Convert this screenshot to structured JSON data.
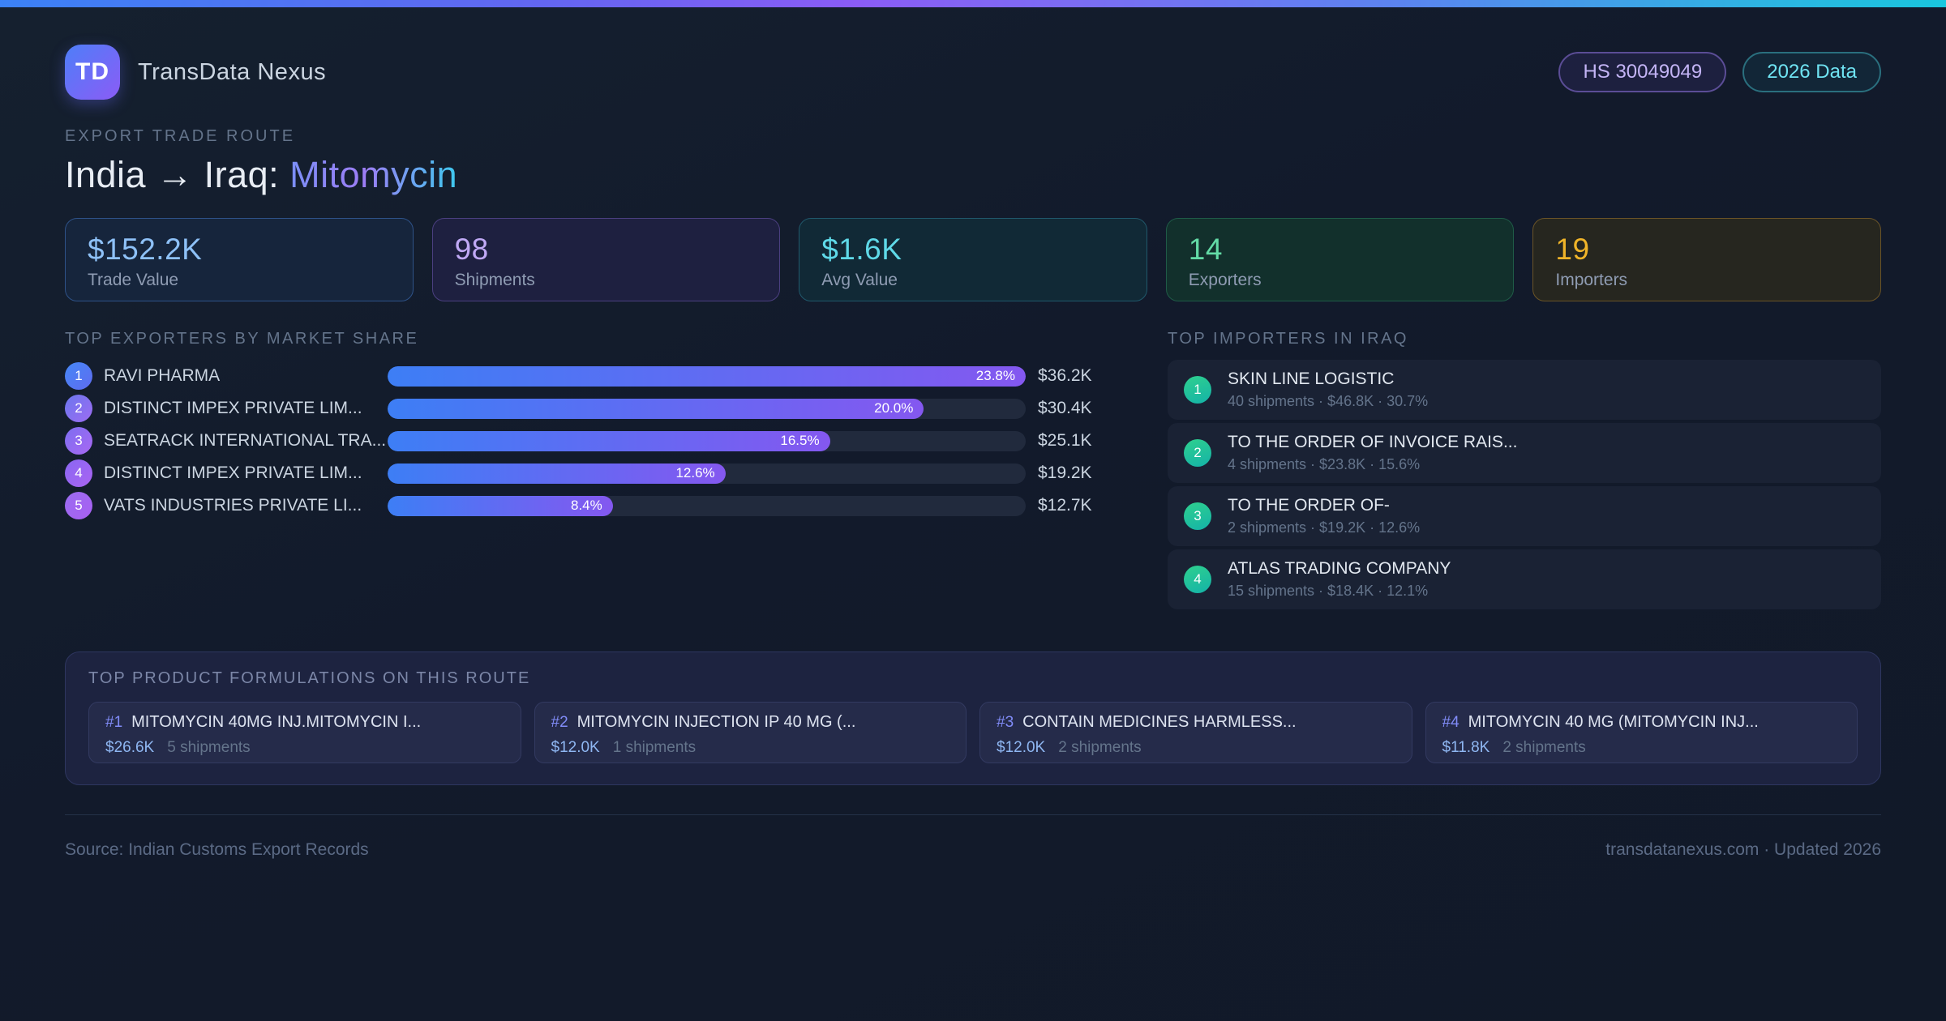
{
  "brand": {
    "logo_text": "TD",
    "app_name": "TransData Nexus"
  },
  "header_badges": {
    "hs_code": "HS 30049049",
    "year_badge": "2026 Data"
  },
  "hero": {
    "eyebrow": "EXPORT TRADE ROUTE",
    "route_label": "India → Iraq:",
    "product": "Mitomycin"
  },
  "colors": {
    "topbar_gradient": [
      "#3b82f6",
      "#8b5cf6",
      "#22d3ee"
    ],
    "bar_fill_start": "#3d7ef5",
    "bar_fill_end": "#8458f0",
    "stat_accents": [
      "#8ec1f7",
      "#c0a9f5",
      "#5fd9e8",
      "#63dba6",
      "#f0b429"
    ],
    "importer_badge": [
      "#2fd08e",
      "#14b3a8"
    ]
  },
  "stats": [
    {
      "value": "$152.2K",
      "label": "Trade Value"
    },
    {
      "value": "98",
      "label": "Shipments"
    },
    {
      "value": "$1.6K",
      "label": "Avg Value"
    },
    {
      "value": "14",
      "label": "Exporters"
    },
    {
      "value": "19",
      "label": "Importers"
    }
  ],
  "exporters": {
    "title": "TOP EXPORTERS BY MARKET SHARE",
    "items": [
      {
        "rank": "1",
        "name": "RAVI PHARMA",
        "share_pct": 23.8,
        "share_label": "23.8%",
        "value": "$36.2K"
      },
      {
        "rank": "2",
        "name": "DISTINCT IMPEX PRIVATE LIM...",
        "share_pct": 20.0,
        "share_label": "20.0%",
        "value": "$30.4K"
      },
      {
        "rank": "3",
        "name": "SEATRACK INTERNATIONAL TRA...",
        "share_pct": 16.5,
        "share_label": "16.5%",
        "value": "$25.1K"
      },
      {
        "rank": "4",
        "name": "DISTINCT IMPEX PRIVATE LIM...",
        "share_pct": 12.6,
        "share_label": "12.6%",
        "value": "$19.2K"
      },
      {
        "rank": "5",
        "name": "VATS INDUSTRIES PRIVATE LI...",
        "share_pct": 8.4,
        "share_label": "8.4%",
        "value": "$12.7K"
      }
    ]
  },
  "importers": {
    "title": "TOP IMPORTERS IN IRAQ",
    "items": [
      {
        "rank": "1",
        "name": "SKIN LINE LOGISTIC",
        "meta": "40 shipments · $46.8K · 30.7%"
      },
      {
        "rank": "2",
        "name": "TO THE ORDER OF INVOICE RAIS...",
        "meta": "4 shipments · $23.8K · 15.6%"
      },
      {
        "rank": "3",
        "name": "TO THE ORDER OF-",
        "meta": "2 shipments · $19.2K · 12.6%"
      },
      {
        "rank": "4",
        "name": "ATLAS TRADING COMPANY",
        "meta": "15 shipments · $18.4K · 12.1%"
      }
    ]
  },
  "products": {
    "title": "TOP PRODUCT FORMULATIONS ON THIS ROUTE",
    "items": [
      {
        "rank": "#1",
        "name": "MITOMYCIN 40MG INJ.MITOMYCIN I...",
        "value": "$26.6K",
        "shipments": "5 shipments"
      },
      {
        "rank": "#2",
        "name": "MITOMYCIN INJECTION IP 40 MG (...",
        "value": "$12.0K",
        "shipments": "1 shipments"
      },
      {
        "rank": "#3",
        "name": "CONTAIN MEDICINES HARMLESS...",
        "value": "$12.0K",
        "shipments": "2 shipments"
      },
      {
        "rank": "#4",
        "name": "MITOMYCIN 40 MG (MITOMYCIN INJ...",
        "value": "$11.8K",
        "shipments": "2 shipments"
      }
    ]
  },
  "footer": {
    "source": "Source: Indian Customs Export Records",
    "site": "transdatanexus.com · Updated 2026"
  }
}
